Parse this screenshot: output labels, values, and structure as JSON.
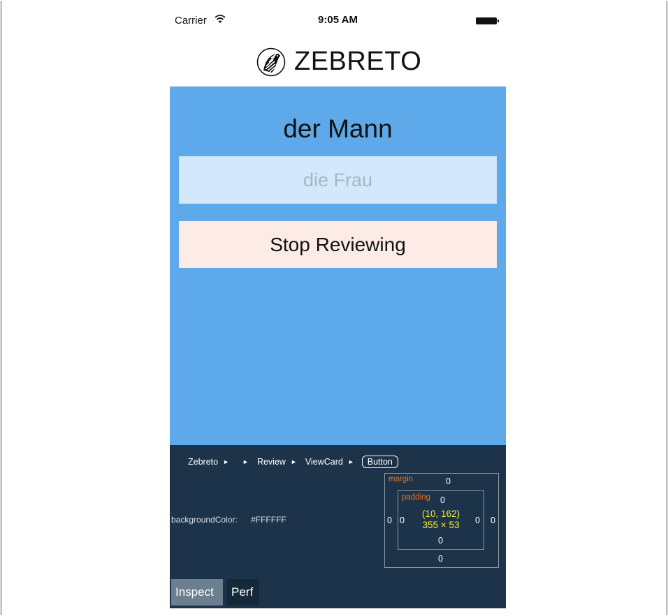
{
  "status_bar": {
    "carrier": "Carrier",
    "time": "9:05 AM",
    "icons": [
      "wifi-icon",
      "battery-icon"
    ]
  },
  "header": {
    "title": "ZEBRETO",
    "logo_icon": "zebra-logo-icon"
  },
  "card": {
    "word": "der Mann",
    "answer_placeholder": "die Frau",
    "stop_button_label": "Stop Reviewing",
    "background_color": "#5da9e9",
    "input_color": "#d3e8fb",
    "button_color": "#fdece6"
  },
  "inspector": {
    "breadcrumb": [
      "Zebreto",
      "",
      "Review",
      "ViewCard",
      "Button"
    ],
    "property_name": "backgroundColor:",
    "property_value": "#FFFFFF",
    "box_model": {
      "margin_label": "margin",
      "padding_label": "padding",
      "margin_top": "0",
      "margin_bottom": "0",
      "margin_left": "0",
      "margin_right": "0",
      "padding_top": "0",
      "padding_bottom": "0",
      "padding_left": "0",
      "padding_right": "0",
      "position": "(10, 162)",
      "size": "355 × 53"
    },
    "tabs": [
      "Inspect",
      "Perf"
    ],
    "background_color": "#1d3349"
  }
}
